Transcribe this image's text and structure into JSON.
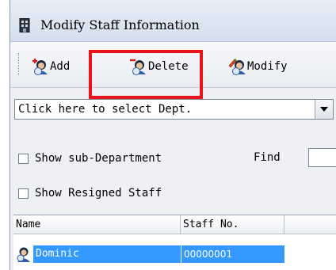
{
  "window": {
    "title": "Modify Staff Information",
    "icon": "app-building-icon"
  },
  "toolbar": {
    "add_label": "Add",
    "delete_label": "Delete",
    "modify_label": "Modify",
    "highlight_color": "#e8141b"
  },
  "dept_select": {
    "value": "Click here to select Dept."
  },
  "filters": {
    "show_sub_department": {
      "label": "Show sub-Department",
      "checked": false
    },
    "show_resigned": {
      "label": "Show Resigned Staff",
      "checked": false
    },
    "find_label": "Find",
    "find_value": ""
  },
  "grid": {
    "columns": [
      "Name",
      "Staff No."
    ],
    "rows": [
      {
        "name": "Dominic",
        "staff_no": "00000001",
        "selected": true
      }
    ],
    "selection_color": "#3399ff"
  }
}
